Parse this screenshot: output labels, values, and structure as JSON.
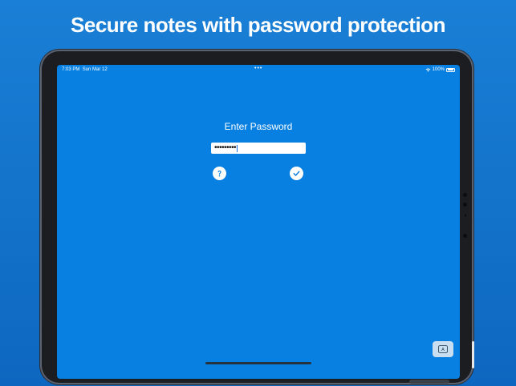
{
  "headline": "Secure notes with password protection",
  "status_bar": {
    "time": "7:03 PM",
    "date": "Sun Mar 12",
    "dots": "•••",
    "battery_text": "100%",
    "wifi_icon": "wifi-icon",
    "battery_icon": "battery-full-icon"
  },
  "login": {
    "title": "Enter Password",
    "password_masked": "•••••••••",
    "help_icon": "question-mark-icon",
    "confirm_icon": "checkmark-icon"
  },
  "keyboard_toggle": {
    "label": "A",
    "icon": "keyboard-icon"
  },
  "colors": {
    "background": "#1474cf",
    "screen": "#0880e2",
    "device_frame": "#1b1d21",
    "button_fill": "#ffffff",
    "icon_blue": "#0880e2"
  }
}
